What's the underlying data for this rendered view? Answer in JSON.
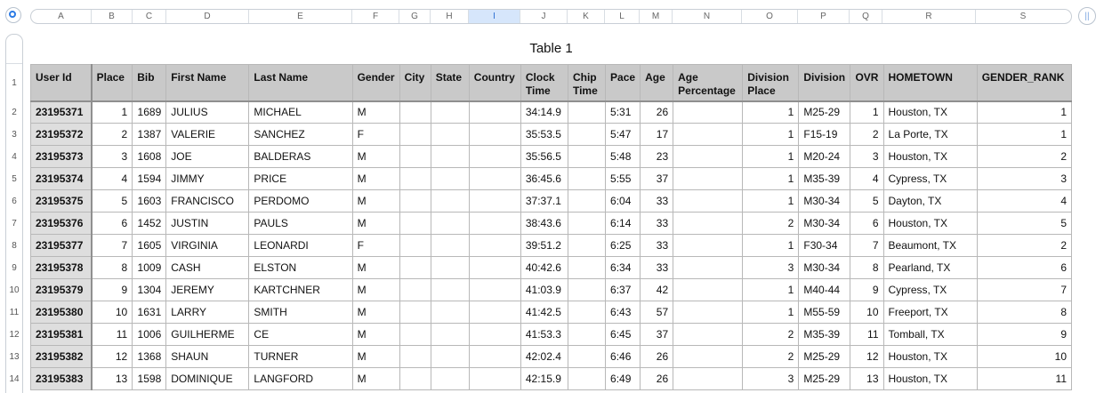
{
  "sheet": {
    "column_letters": [
      "A",
      "B",
      "C",
      "D",
      "E",
      "F",
      "G",
      "H",
      "I",
      "J",
      "K",
      "L",
      "M",
      "N",
      "O",
      "P",
      "Q",
      "R",
      "S"
    ],
    "selected_column": "I",
    "row_numbers": [
      "1",
      "2",
      "3",
      "4",
      "5",
      "6",
      "7",
      "8",
      "9",
      "10",
      "11",
      "12",
      "13",
      "14"
    ]
  },
  "table": {
    "title": "Table 1",
    "headers": [
      "User Id",
      "Place",
      "Bib",
      "First Name",
      "Last Name",
      "Gender",
      "City",
      "State",
      "Country",
      "Clock Time",
      "Chip Time",
      "Pace",
      "Age",
      "Age Percentage",
      "Division Place",
      "Division",
      "OVR",
      "HOMETOWN",
      "GENDER_RANK"
    ],
    "rows": [
      [
        "23195371",
        "1",
        "1689",
        "JULIUS",
        "MICHAEL",
        "M",
        "",
        "",
        "",
        "34:14.9",
        "",
        "5:31",
        "26",
        "",
        "1",
        "M25-29",
        "1",
        "Houston, TX",
        "1"
      ],
      [
        "23195372",
        "2",
        "1387",
        "VALERIE",
        "SANCHEZ",
        "F",
        "",
        "",
        "",
        "35:53.5",
        "",
        "5:47",
        "17",
        "",
        "1",
        "F15-19",
        "2",
        "La Porte, TX",
        "1"
      ],
      [
        "23195373",
        "3",
        "1608",
        "JOE",
        "BALDERAS",
        "M",
        "",
        "",
        "",
        "35:56.5",
        "",
        "5:48",
        "23",
        "",
        "1",
        "M20-24",
        "3",
        "Houston, TX",
        "2"
      ],
      [
        "23195374",
        "4",
        "1594",
        "JIMMY",
        "PRICE",
        "M",
        "",
        "",
        "",
        "36:45.6",
        "",
        "5:55",
        "37",
        "",
        "1",
        "M35-39",
        "4",
        "Cypress, TX",
        "3"
      ],
      [
        "23195375",
        "5",
        "1603",
        "FRANCISCO",
        "PERDOMO",
        "M",
        "",
        "",
        "",
        "37:37.1",
        "",
        "6:04",
        "33",
        "",
        "1",
        "M30-34",
        "5",
        "Dayton, TX",
        "4"
      ],
      [
        "23195376",
        "6",
        "1452",
        "JUSTIN",
        "PAULS",
        "M",
        "",
        "",
        "",
        "38:43.6",
        "",
        "6:14",
        "33",
        "",
        "2",
        "M30-34",
        "6",
        "Houston, TX",
        "5"
      ],
      [
        "23195377",
        "7",
        "1605",
        "VIRGINIA",
        "LEONARDI",
        "F",
        "",
        "",
        "",
        "39:51.2",
        "",
        "6:25",
        "33",
        "",
        "1",
        "F30-34",
        "7",
        "Beaumont, TX",
        "2"
      ],
      [
        "23195378",
        "8",
        "1009",
        "CASH",
        "ELSTON",
        "M",
        "",
        "",
        "",
        "40:42.6",
        "",
        "6:34",
        "33",
        "",
        "3",
        "M30-34",
        "8",
        "Pearland, TX",
        "6"
      ],
      [
        "23195379",
        "9",
        "1304",
        "JEREMY",
        "KARTCHNER",
        "M",
        "",
        "",
        "",
        "41:03.9",
        "",
        "6:37",
        "42",
        "",
        "1",
        "M40-44",
        "9",
        "Cypress, TX",
        "7"
      ],
      [
        "23195380",
        "10",
        "1631",
        "LARRY",
        "SMITH",
        "M",
        "",
        "",
        "",
        "41:42.5",
        "",
        "6:43",
        "57",
        "",
        "1",
        "M55-59",
        "10",
        "Freeport, TX",
        "8"
      ],
      [
        "23195381",
        "11",
        "1006",
        "GUILHERME",
        "CE",
        "M",
        "",
        "",
        "",
        "41:53.3",
        "",
        "6:45",
        "37",
        "",
        "2",
        "M35-39",
        "11",
        "Tomball, TX",
        "9"
      ],
      [
        "23195382",
        "12",
        "1368",
        "SHAUN",
        "TURNER",
        "M",
        "",
        "",
        "",
        "42:02.4",
        "",
        "6:46",
        "26",
        "",
        "2",
        "M25-29",
        "12",
        "Houston, TX",
        "10"
      ],
      [
        "23195383",
        "13",
        "1598",
        "DOMINIQUE",
        "LANGFORD",
        "M",
        "",
        "",
        "",
        "42:15.9",
        "",
        "6:49",
        "26",
        "",
        "3",
        "M25-29",
        "13",
        "Houston, TX",
        "11"
      ]
    ]
  }
}
